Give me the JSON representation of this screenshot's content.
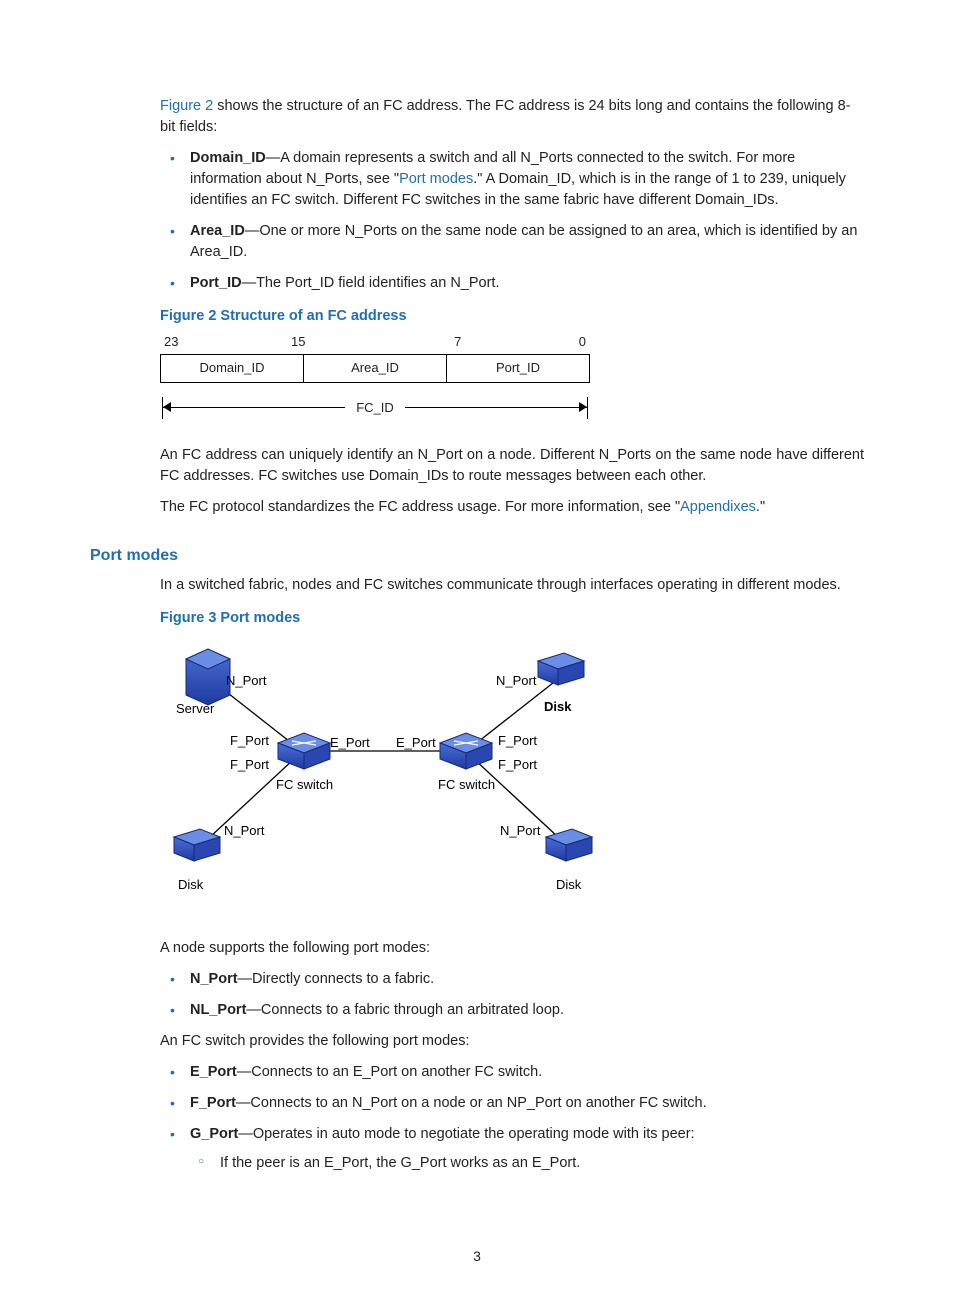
{
  "intro": {
    "prefix": "Figure 2",
    "rest": " shows the structure of an FC address. The FC address is 24 bits long and contains the following 8-bit fields:"
  },
  "bullets1": [
    {
      "term": "Domain_ID",
      "pre": "—A domain represents a switch and all N_Ports connected to the switch. For more information about N_Ports, see \"",
      "link": "Port modes",
      "post": ".\" A Domain_ID, which is in the range of 1 to 239, uniquely identifies an FC switch. Different FC switches in the same fabric have different Domain_IDs."
    },
    {
      "term": "Area_ID",
      "text": "—One or more N_Ports on the same node can be assigned to an area, which is identified by an Area_ID."
    },
    {
      "term": "Port_ID",
      "text": "—The Port_ID field identifies an N_Port."
    }
  ],
  "fig2": {
    "caption": "Figure 2 Structure of an FC address",
    "ticks": [
      "23",
      "15",
      "7",
      "0"
    ],
    "cells": [
      "Domain_ID",
      "Area_ID",
      "Port_ID"
    ],
    "bracket": "FC_ID"
  },
  "after_fig2_p1": "An FC address can uniquely identify an N_Port on a node. Different N_Ports on the same node have different FC addresses. FC switches use Domain_IDs to route messages between each other.",
  "after_fig2_p2_pre": "The FC protocol standardizes the FC address usage. For more information, see \"",
  "after_fig2_p2_link": "Appendixes",
  "after_fig2_p2_post": ".\"",
  "h_port_modes": "Port modes",
  "port_modes_p": "In a switched fabric, nodes and FC switches communicate through interfaces operating in different modes.",
  "fig3": {
    "caption": "Figure 3 Port modes",
    "labels": {
      "server": "Server",
      "disk_tr": "Disk",
      "disk_bl": "Disk",
      "disk_br": "Disk",
      "fcsw_l": "FC switch",
      "fcsw_r": "FC switch",
      "nport": "N_Port",
      "fport": "F_Port",
      "eport": "E_Port"
    }
  },
  "node_intro": "A node supports the following port modes:",
  "node_list": [
    {
      "term": "N_Port",
      "text": "—Directly connects to a fabric."
    },
    {
      "term": "NL_Port",
      "text": "—Connects to a fabric through an arbitrated loop."
    }
  ],
  "switch_intro": "An FC switch provides the following port modes:",
  "switch_list": [
    {
      "term": "E_Port",
      "text": "—Connects to an E_Port on another FC switch."
    },
    {
      "term": "F_Port",
      "text": "—Connects to an N_Port on a node or an NP_Port on another FC switch."
    },
    {
      "term": "G_Port",
      "text": "—Operates in auto mode to negotiate the operating mode with its peer:",
      "sub": [
        "If the peer is an E_Port, the G_Port works as an E_Port."
      ]
    }
  ],
  "page_number": "3"
}
